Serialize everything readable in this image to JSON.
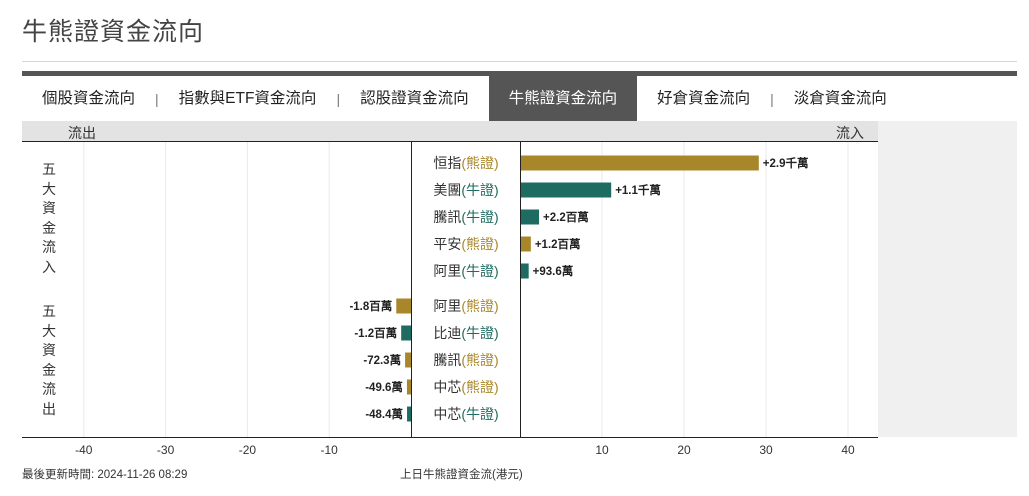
{
  "page": {
    "title": "牛熊證資金流向"
  },
  "tabs": [
    {
      "label": "個股資金流向",
      "active": false
    },
    {
      "label": "指數與ETF資金流向",
      "active": false
    },
    {
      "label": "認股證資金流向",
      "active": false
    },
    {
      "label": "牛熊證資金流向",
      "active": true
    },
    {
      "label": "好倉資金流向",
      "active": false
    },
    {
      "label": "淡倉資金流向",
      "active": false
    }
  ],
  "headers": {
    "outflow": "流出",
    "inflow": "流入"
  },
  "side_labels": {
    "top5_inflow": "五大資金流入",
    "top5_outflow": "五大資金流出"
  },
  "colors": {
    "bear": "#a8872a",
    "bull": "#1e6b62",
    "tab_active": "#555555"
  },
  "chart_data": {
    "type": "bar",
    "orientation": "horizontal",
    "unit": "百萬港元",
    "xlim": [
      -45,
      45
    ],
    "xticks": [
      -40,
      -30,
      -20,
      -10,
      10,
      20,
      30,
      40
    ],
    "grid": true,
    "groups": [
      {
        "name": "五大資金流入",
        "items": [
          {
            "name": "恒指",
            "type": "熊證",
            "value": 29,
            "label": "+2.9千萬"
          },
          {
            "name": "美團",
            "type": "牛證",
            "value": 11,
            "label": "+1.1千萬"
          },
          {
            "name": "騰訊",
            "type": "牛證",
            "value": 2.2,
            "label": "+2.2百萬"
          },
          {
            "name": "平安",
            "type": "熊證",
            "value": 1.2,
            "label": "+1.2百萬"
          },
          {
            "name": "阿里",
            "type": "牛證",
            "value": 0.936,
            "label": "+93.6萬"
          }
        ]
      },
      {
        "name": "五大資金流出",
        "items": [
          {
            "name": "阿里",
            "type": "熊證",
            "value": -1.8,
            "label": "-1.8百萬"
          },
          {
            "name": "比迪",
            "type": "牛證",
            "value": -1.2,
            "label": "-1.2百萬"
          },
          {
            "name": "騰訊",
            "type": "熊證",
            "value": -0.723,
            "label": "-72.3萬"
          },
          {
            "name": "中芯",
            "type": "熊證",
            "value": -0.496,
            "label": "-49.6萬"
          },
          {
            "name": "中芯",
            "type": "牛證",
            "value": -0.484,
            "label": "-48.4萬"
          }
        ]
      }
    ]
  },
  "footer": {
    "updated": "最後更新時間: 2024-11-26 08:29",
    "caption": "上日牛熊證資金流(港元)"
  }
}
